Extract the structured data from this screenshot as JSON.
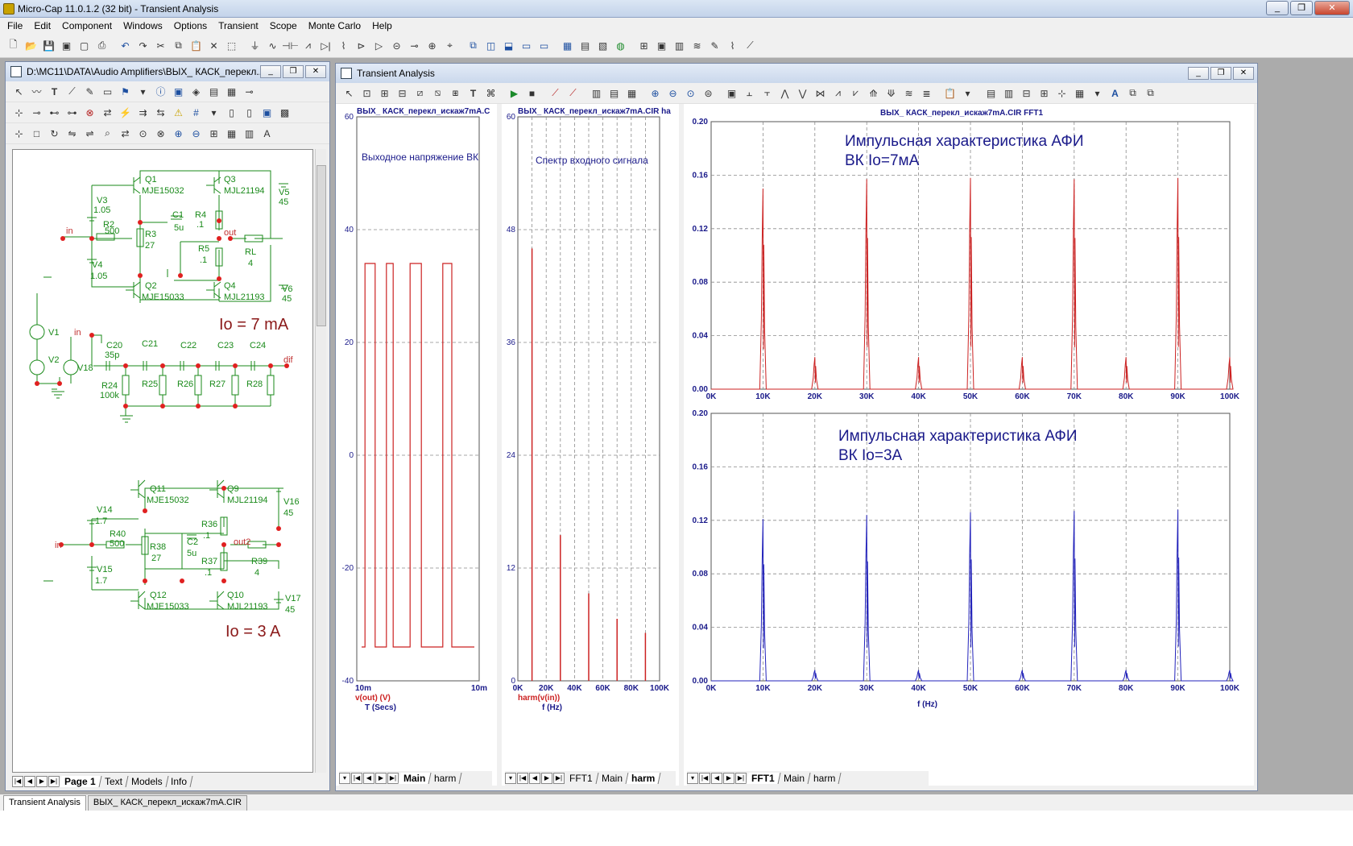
{
  "app": {
    "title": "Micro-Cap 11.0.1.2 (32 bit) - Transient Analysis"
  },
  "menu": [
    "File",
    "Edit",
    "Component",
    "Windows",
    "Options",
    "Transient",
    "Scope",
    "Monte Carlo",
    "Help"
  ],
  "schematic_window": {
    "title": "D:\\MC11\\DATA\\Audio Amplifiers\\ВЫХ_ КАСК_перекл...",
    "tabs": [
      "Page 1",
      "Text",
      "Models",
      "Info"
    ],
    "labels": {
      "q1": "Q1",
      "q1m": "MJE15032",
      "q3": "Q3",
      "q3m": "MJL21194",
      "v5": "V5",
      "v5v": "45",
      "v3": "V3",
      "v3v": "1.05",
      "r2": "R2",
      "r2v": "500",
      "c1": "C1",
      "c1v": "5u",
      "r4": "R4",
      "r4v": ".1",
      "in1": "in",
      "r3": "R3",
      "r3v": "27",
      "out": "out",
      "r5": "R5",
      "r5v": ".1",
      "rl": "RL",
      "rlv": "4",
      "v4": "V4",
      "v4v": "1.05",
      "q2": "Q2",
      "q2m": "MJE15033",
      "q4": "Q4",
      "q4m": "MJL21193",
      "v6": "V6",
      "v6v": "45",
      "v1": "V1",
      "v2": "V2",
      "in2": "in",
      "io1": "Io = 7 mA",
      "c20": "C20",
      "c20v": "35p",
      "c21": "C21",
      "c22": "C22",
      "c23": "C23",
      "c24": "C24",
      "dif": "dif",
      "v18": "V18",
      "r24": "R24",
      "r24v": "100k",
      "r25": "R25",
      "r26": "R26",
      "r27": "R27",
      "r28": "R28",
      "q11": "Q11",
      "q11m": "MJE15032",
      "q9": "Q9",
      "q9m": "MJL21194",
      "v16": "V16",
      "v16v": "45",
      "v14": "V14",
      "v14v": "1.7",
      "r36": "R36",
      "r36v": ".1",
      "in3": "in",
      "r40": "R40",
      "r40v": "500",
      "r38": "R38",
      "r38v": "27",
      "c2": "C2",
      "c2v": "5u",
      "out2": "out2",
      "r37": "R37",
      "r37v": ".1",
      "r39": "R39",
      "r39v": "4",
      "v15": "V15",
      "v15v": "1.7",
      "q12": "Q12",
      "q12m": "MJE15033",
      "q10": "Q10",
      "q10m": "MJL21193",
      "v17": "V17",
      "v17v": "45",
      "io2": "Io = 3 A"
    }
  },
  "analysis_window": {
    "title": "Transient Analysis",
    "panel1": {
      "header": "ВЫХ_ КАСК_перекл_искаж7mA.C",
      "annotation": "Выходное напряжение ВК",
      "y_ticks": [
        "60",
        "40",
        "20",
        "0",
        "-20",
        "-40"
      ],
      "x_left": "10m",
      "x_right": "10m",
      "trace_label": "v(out) (V)",
      "x_label": "T (Secs)",
      "tabs": [
        "Main",
        "harm"
      ],
      "chart_data": {
        "type": "line",
        "ylim": [
          -40,
          60
        ],
        "x": [
          0,
          0.03,
          0.03,
          0.12,
          0.12,
          0.22,
          0.22,
          0.28,
          0.28,
          0.43,
          0.43,
          0.53,
          0.53,
          0.72,
          0.72,
          0.8,
          0.8,
          1.0
        ],
        "y": [
          -34,
          -34,
          34,
          34,
          -34,
          -34,
          34,
          34,
          -34,
          -34,
          34,
          34,
          -34,
          -34,
          34,
          34,
          -34,
          -34
        ]
      }
    },
    "panel2": {
      "header": "ВЫХ_ КАСК_перекл_искаж7mA.CIR ha",
      "annotation": "Спектр входного сигнала",
      "y_ticks": [
        "60",
        "48",
        "36",
        "24",
        "12",
        "0"
      ],
      "x_ticks": [
        "0K",
        "20K",
        "40K",
        "60K",
        "80K",
        "100K"
      ],
      "trace_label": "harm(v(in))",
      "x_label": "f (Hz)",
      "tabs": [
        "FFT1",
        "Main",
        "harm"
      ],
      "chart_data": {
        "type": "bar",
        "ylim": [
          0,
          60
        ],
        "xlim": [
          0,
          100000
        ],
        "x": [
          10000,
          30000,
          50000,
          70000,
          90000
        ],
        "values": [
          46,
          15.5,
          9.3,
          6.6,
          5.1
        ]
      }
    },
    "panel3": {
      "header": "ВЫХ_ КАСК_перекл_искаж7mA.CIR FFT1",
      "top": {
        "title_line1": "Импульсная характеристика АФИ",
        "title_line2": "ВК Io=7мА",
        "y_ticks": [
          "0.20",
          "0.16",
          "0.12",
          "0.08",
          "0.04",
          "0.00"
        ],
        "x_ticks": [
          "0K",
          "10K",
          "20K",
          "30K",
          "40K",
          "50K",
          "60K",
          "70K",
          "80K",
          "90K",
          "100K"
        ],
        "color": "#cc2222",
        "chart_data": {
          "type": "line",
          "ylim": [
            0,
            0.2
          ],
          "xlim": [
            0,
            100000
          ],
          "peaks_x": [
            10000,
            20000,
            30000,
            40000,
            50000,
            60000,
            70000,
            80000,
            90000,
            100000
          ],
          "peaks_y": [
            0.15,
            0.024,
            0.157,
            0.024,
            0.158,
            0.024,
            0.157,
            0.024,
            0.158,
            0.024
          ]
        }
      },
      "bottom": {
        "title_line1": "Импульсная характеристика АФИ",
        "title_line2": "ВК Io=3А",
        "y_ticks": [
          "0.20",
          "0.16",
          "0.12",
          "0.08",
          "0.04",
          "0.00"
        ],
        "x_ticks": [
          "0K",
          "10K",
          "20K",
          "30K",
          "40K",
          "50K",
          "60K",
          "70K",
          "80K",
          "90K",
          "100K"
        ],
        "x_label": "f (Hz)",
        "color": "#2222bb",
        "chart_data": {
          "type": "line",
          "ylim": [
            0,
            0.2
          ],
          "xlim": [
            0,
            100000
          ],
          "peaks_x": [
            10000,
            20000,
            30000,
            40000,
            50000,
            60000,
            70000,
            80000,
            90000,
            100000
          ],
          "peaks_y": [
            0.121,
            0.008,
            0.124,
            0.008,
            0.126,
            0.008,
            0.127,
            0.008,
            0.128,
            0.008
          ]
        }
      },
      "tabs": [
        "FFT1",
        "Main",
        "harm"
      ]
    }
  },
  "taskbar": [
    "Transient Analysis",
    "ВЫХ_ КАСК_перекл_искаж7mA.CIR"
  ]
}
